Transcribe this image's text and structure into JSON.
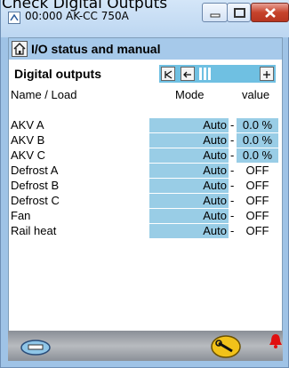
{
  "caption": "Check Digital Outputs",
  "window": {
    "title": "00:000 AK-CC 750A"
  },
  "section": {
    "title": "I/O status and manual"
  },
  "subheader": {
    "title": "Digital outputs"
  },
  "columns": {
    "name": "Name / Load",
    "mode": "Mode",
    "value": "value"
  },
  "rows": [
    {
      "name": "AKV A",
      "mode": "Auto",
      "dash": "-",
      "value": "0.0 %",
      "boxed": true
    },
    {
      "name": "AKV B",
      "mode": "Auto",
      "dash": "-",
      "value": "0.0 %",
      "boxed": true
    },
    {
      "name": "AKV C",
      "mode": "Auto",
      "dash": "-",
      "value": "0.0 %",
      "boxed": true
    },
    {
      "name": "Defrost A",
      "mode": "Auto",
      "dash": "-",
      "value": "OFF",
      "boxed": false
    },
    {
      "name": "Defrost B",
      "mode": "Auto",
      "dash": "-",
      "value": "OFF",
      "boxed": false
    },
    {
      "name": "Defrost C",
      "mode": "Auto",
      "dash": "-",
      "value": "OFF",
      "boxed": false
    },
    {
      "name": "Fan",
      "mode": "Auto",
      "dash": "-",
      "value": "OFF",
      "boxed": false
    },
    {
      "name": "Rail heat",
      "mode": "Auto",
      "dash": "-",
      "value": "OFF",
      "boxed": false
    }
  ],
  "icons": {
    "app": "app-icon",
    "home": "home-icon",
    "first": "skip-first-icon",
    "prev": "previous-icon",
    "next": "next-icon",
    "footer_left": "lozenge-icon",
    "footer_tool": "wrench-icon",
    "footer_alarm": "alarm-bell-icon"
  },
  "colors": {
    "titlebar": "#bcd6f1",
    "section_header": "#a6c9ea",
    "cell_highlight": "#99cde6",
    "pager": "#6fc0e2",
    "close": "#c7432c",
    "alarm": "#e01010"
  }
}
